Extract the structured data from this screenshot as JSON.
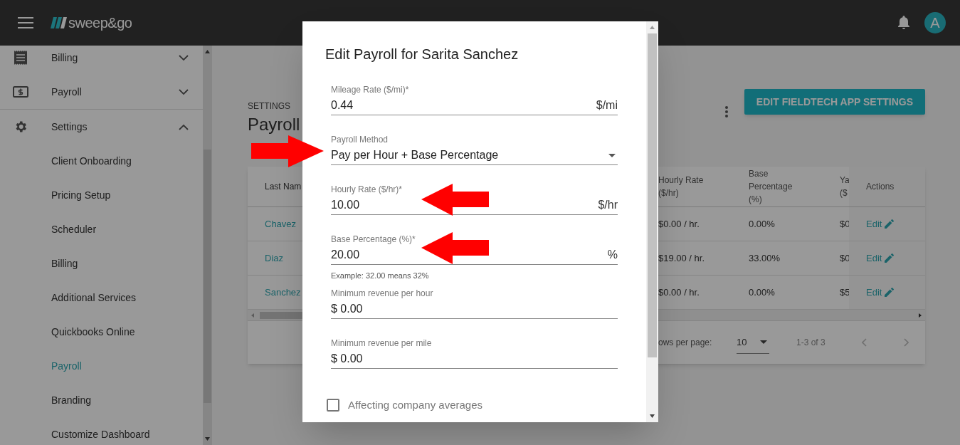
{
  "app_bar": {
    "logo_text": "sweep&go",
    "avatar_letter": "A"
  },
  "sidebar": {
    "items": [
      {
        "label": "Billing",
        "expanded": false
      },
      {
        "label": "Payroll",
        "expanded": false
      },
      {
        "label": "Settings",
        "expanded": true,
        "children": [
          {
            "label": "Client Onboarding",
            "selected": false
          },
          {
            "label": "Pricing Setup",
            "selected": false
          },
          {
            "label": "Scheduler",
            "selected": false
          },
          {
            "label": "Billing",
            "selected": false
          },
          {
            "label": "Additional Services",
            "selected": false
          },
          {
            "label": "Quickbooks Online",
            "selected": false
          },
          {
            "label": "Payroll",
            "selected": true
          },
          {
            "label": "Branding",
            "selected": false
          },
          {
            "label": "Customize Dashboard",
            "selected": false
          }
        ]
      }
    ]
  },
  "page": {
    "breadcrumb": "SETTINGS",
    "title": "Payroll",
    "primary_button": "EDIT FIELDTECH APP SETTINGS"
  },
  "table": {
    "left_columns": [
      "Last Nam"
    ],
    "right_columns": [
      "Hourly Rate ($/hr)",
      "Base Percentage (%)",
      "Ya ($",
      "Actions"
    ],
    "rows": [
      {
        "last_name": "Chavez",
        "cells": [
          "$0.00 / hr.",
          "0.00%",
          "$0"
        ],
        "action": "Edit"
      },
      {
        "last_name": "Diaz",
        "cells": [
          "$19.00 / hr.",
          "33.00%",
          "$0"
        ],
        "action": "Edit"
      },
      {
        "last_name": "Sanchez",
        "cells": [
          "$0.00 / hr.",
          "0.00%",
          "$5"
        ],
        "action": "Edit"
      }
    ],
    "footer": {
      "rows_per_page_label": "ows per page:",
      "rows_per_page": "10",
      "range": "1-3 of 3"
    }
  },
  "dialog": {
    "title": "Edit Payroll for Sarita Sanchez",
    "fields": [
      {
        "kind": "input",
        "label": "Mileage Rate ($/mi)*",
        "value": "0.44",
        "suffix": "$/mi"
      },
      {
        "kind": "select",
        "label": "Payroll Method",
        "value": "Pay per Hour + Base Percentage"
      },
      {
        "kind": "input",
        "label": "Hourly Rate ($/hr)*",
        "value": "10.00",
        "suffix": "$/hr"
      },
      {
        "kind": "input",
        "label": "Base Percentage (%)*",
        "value": "20.00",
        "suffix": "%",
        "hint": "Example: 32.00 means 32%"
      },
      {
        "kind": "input",
        "label": "Minimum revenue per hour",
        "value": "$ 0.00"
      },
      {
        "kind": "input",
        "label": "Minimum revenue per mile",
        "value": "$ 0.00"
      }
    ],
    "checkbox": {
      "label": "Affecting company averages",
      "checked": false
    }
  }
}
